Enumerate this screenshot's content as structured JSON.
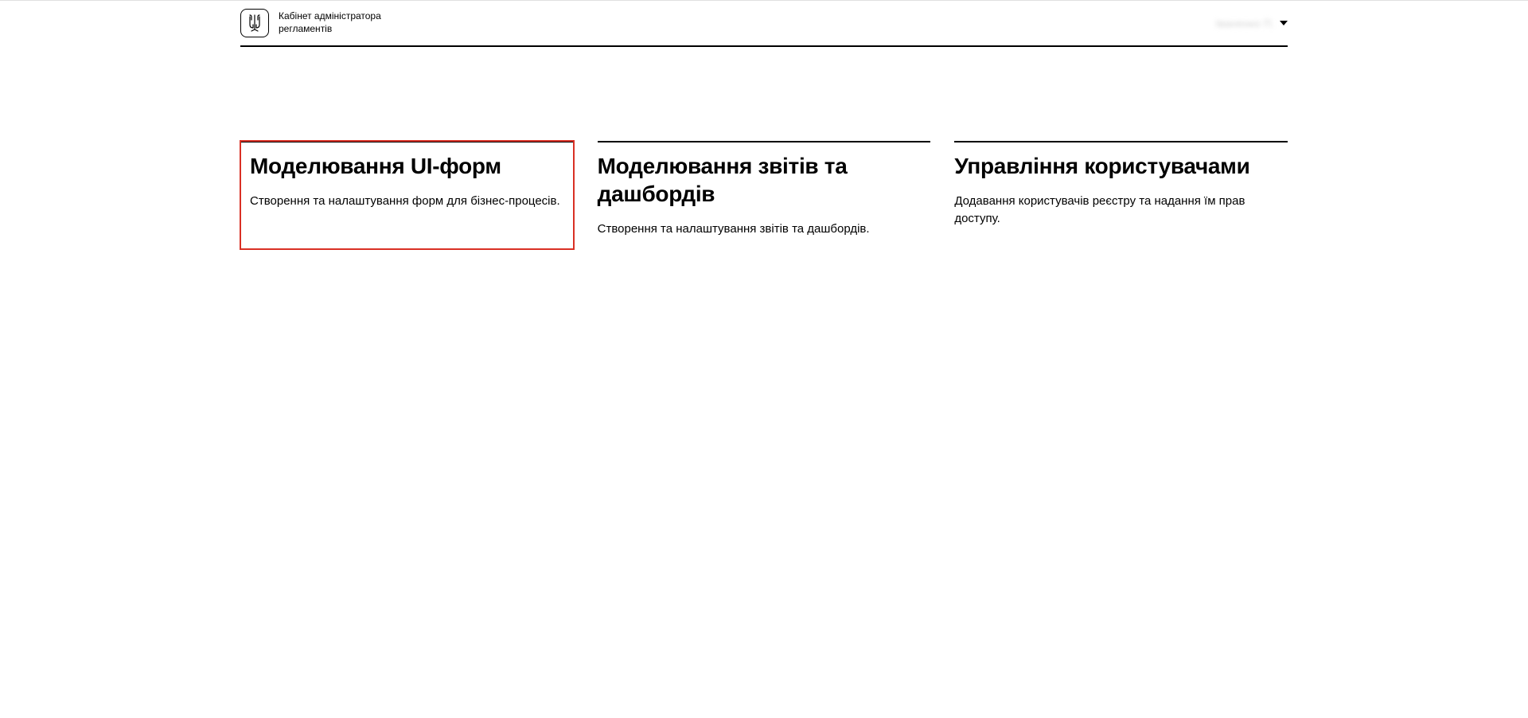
{
  "header": {
    "title_line1": "Кабінет адміністратора",
    "title_line2": "регламентів",
    "user_placeholder": "Іваненко П."
  },
  "cards": [
    {
      "title": "Моделювання UI-форм",
      "description": "Створення та налаштування форм для бізнес-процесів.",
      "highlighted": true
    },
    {
      "title": "Моделювання звітів та дашбордів",
      "description": "Створення та налаштування звітів та дашбордів.",
      "highlighted": false
    },
    {
      "title": "Управління користувачами",
      "description": "Додавання користувачів реєстру та надання їм прав доступу.",
      "highlighted": false
    }
  ]
}
